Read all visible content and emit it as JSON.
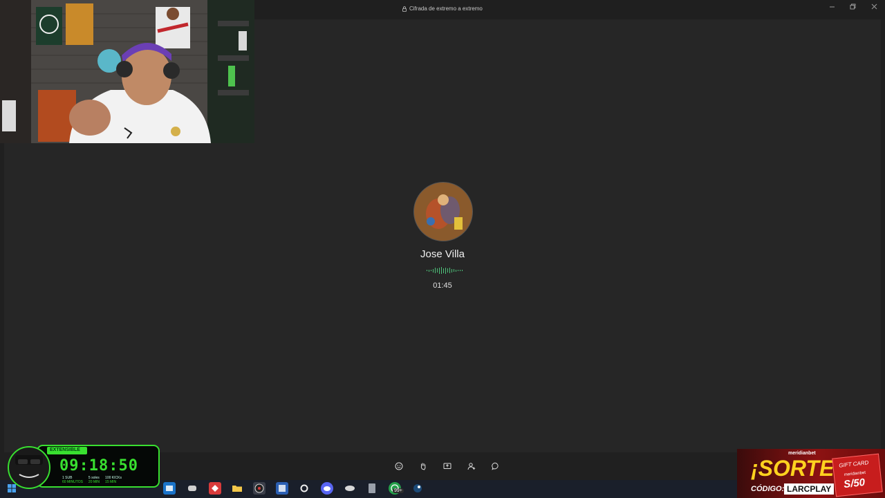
{
  "window": {
    "encryption_label": "Cifrada de extremo a extremo",
    "controls": [
      "minimize",
      "restore",
      "close"
    ]
  },
  "call": {
    "contact_name": "Jose Villa",
    "duration": "01:45",
    "status_color": "#4ec27a"
  },
  "call_controls": [
    {
      "name": "emoji-icon"
    },
    {
      "name": "raise-hand-icon"
    },
    {
      "name": "share-screen-icon"
    },
    {
      "name": "add-participant-icon"
    },
    {
      "name": "chat-icon"
    }
  ],
  "stream_overlay": {
    "badge": "EXTENSIBLE",
    "countdown": "09:18:50",
    "rules": [
      {
        "top": "1 SUB",
        "bottom": "60 MINUTOS"
      },
      {
        "top": "5 soles",
        "bottom": "20 MIN"
      },
      {
        "top": "100 KICKs",
        "bottom": "15 MIN"
      }
    ]
  },
  "promo": {
    "brand": "meridianbet",
    "headline": "¡SORTEO!",
    "code_label": "CÓDIGO:",
    "code": "LARCPLAY",
    "card_title": "GIFT CARD",
    "card_brand": "meridianbet",
    "card_value": "S/50"
  },
  "taskbar": {
    "badge_count": "99+",
    "accent": "#1a1f2a"
  }
}
